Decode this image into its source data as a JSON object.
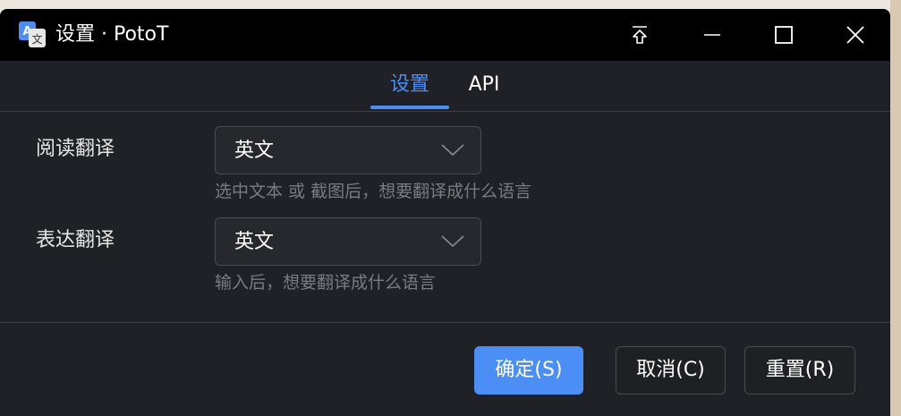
{
  "window": {
    "title": "设置 · PotoT",
    "icon": "translate-app-icon"
  },
  "titlebar": {
    "pin_icon": "pin-icon",
    "minimize_icon": "minimize-icon",
    "maximize_icon": "maximize-icon",
    "close_icon": "close-icon"
  },
  "tabs": [
    {
      "label": "设置",
      "active": true
    },
    {
      "label": "API",
      "active": false
    }
  ],
  "settings": {
    "reading": {
      "label": "阅读翻译",
      "value": "英文",
      "hint": "选中文本 或 截图后，想要翻译成什么语言"
    },
    "expression": {
      "label": "表达翻译",
      "value": "英文",
      "hint": "输入后，想要翻译成什么语言"
    }
  },
  "buttons": {
    "ok": "确定(S)",
    "cancel": "取消(C)",
    "reset": "重置(R)"
  },
  "colors": {
    "accent": "#4b8ef5",
    "window_bg": "#202126",
    "titlebar_bg": "#000000"
  }
}
